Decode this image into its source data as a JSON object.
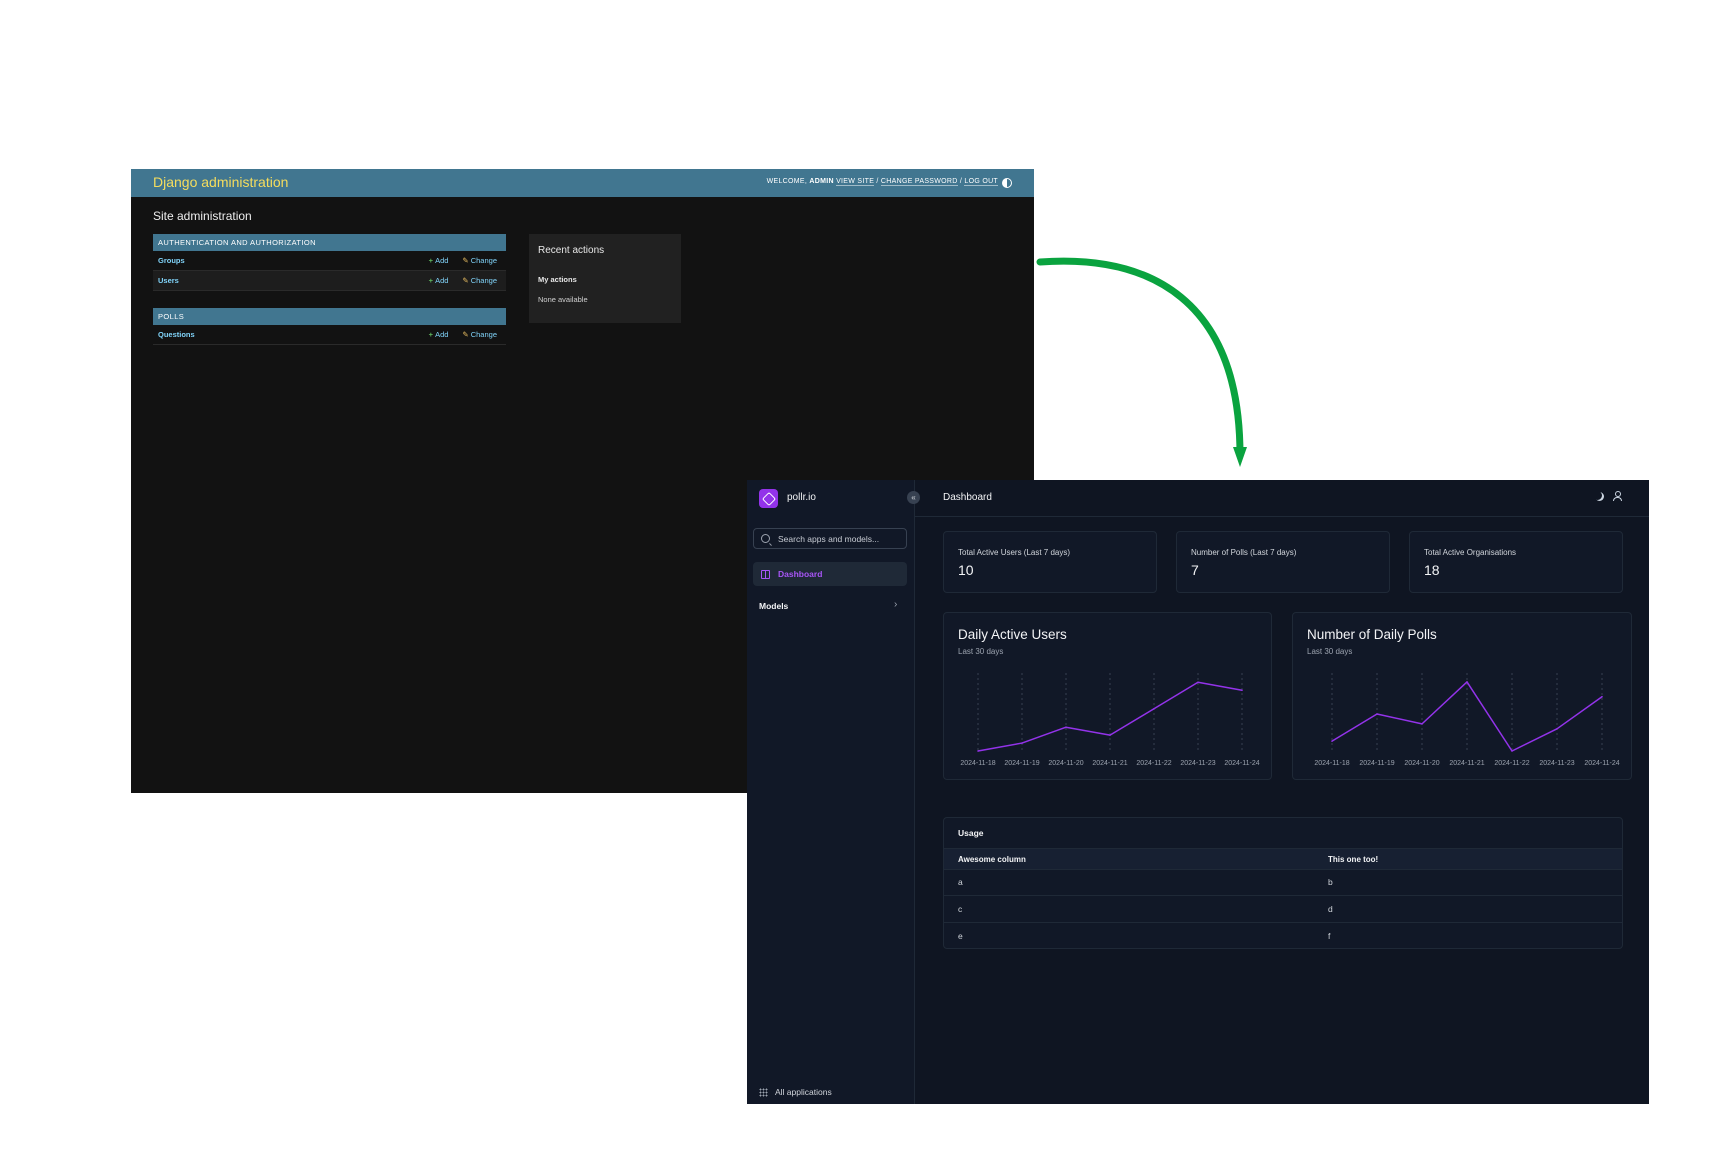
{
  "django": {
    "branding": "Django administration",
    "usertools": {
      "welcome": "WELCOME,",
      "user": "ADMIN",
      "view_site": "VIEW SITE",
      "sep1": "/",
      "change_password": "CHANGE PASSWORD",
      "sep2": "/",
      "logout": "LOG OUT"
    },
    "page_title": "Site administration",
    "modules": [
      {
        "caption": "Authentication and Authorization",
        "rows": [
          {
            "name": "Groups",
            "add": "Add",
            "change": "Change"
          },
          {
            "name": "Users",
            "add": "Add",
            "change": "Change"
          }
        ]
      },
      {
        "caption": "Polls",
        "rows": [
          {
            "name": "Questions",
            "add": "Add",
            "change": "Change"
          }
        ]
      }
    ],
    "recent": {
      "title": "Recent actions",
      "subtitle": "My actions",
      "none": "None available"
    }
  },
  "arrow_color": "#0aa33f",
  "unfold": {
    "site_name": "pollr.io",
    "accent": "#9333ea",
    "search_placeholder": "Search apps and models...",
    "nav": {
      "dashboard": "Dashboard",
      "models": "Models",
      "all_apps": "All applications"
    },
    "page_title": "Dashboard",
    "kpis": [
      {
        "label": "Total Active Users (Last 7 days)",
        "value": "10"
      },
      {
        "label": "Number of Polls (Last 7 days)",
        "value": "7"
      },
      {
        "label": "Total Active Organisations",
        "value": "18"
      }
    ],
    "table": {
      "title": "Usage",
      "columns": [
        "Awesome column",
        "This one too!"
      ],
      "rows": [
        [
          "a",
          "b"
        ],
        [
          "c",
          "d"
        ],
        [
          "e",
          "f"
        ]
      ]
    }
  },
  "chart_data": [
    {
      "type": "line",
      "title": "Daily Active Users",
      "subtitle": "Last 30 days",
      "categories": [
        "2024-11-18",
        "2024-11-19",
        "2024-11-20",
        "2024-11-21",
        "2024-11-22",
        "2024-11-23",
        "2024-11-24"
      ],
      "values": [
        0,
        1.5,
        4.5,
        3,
        8,
        13,
        11.5
      ],
      "ylim": [
        0,
        14
      ],
      "color": "#9333ea",
      "grid": "vertical-dashed"
    },
    {
      "type": "line",
      "title": "Number of Daily Polls",
      "subtitle": "Last 30 days",
      "categories": [
        "2024-11-18",
        "2024-11-19",
        "2024-11-20",
        "2024-11-21",
        "2024-11-22",
        "2024-11-23",
        "2024-11-24"
      ],
      "values": [
        2,
        7.5,
        5.5,
        14,
        0,
        4.5,
        11
      ],
      "ylim": [
        0,
        15
      ],
      "color": "#9333ea",
      "grid": "vertical-dashed"
    }
  ]
}
